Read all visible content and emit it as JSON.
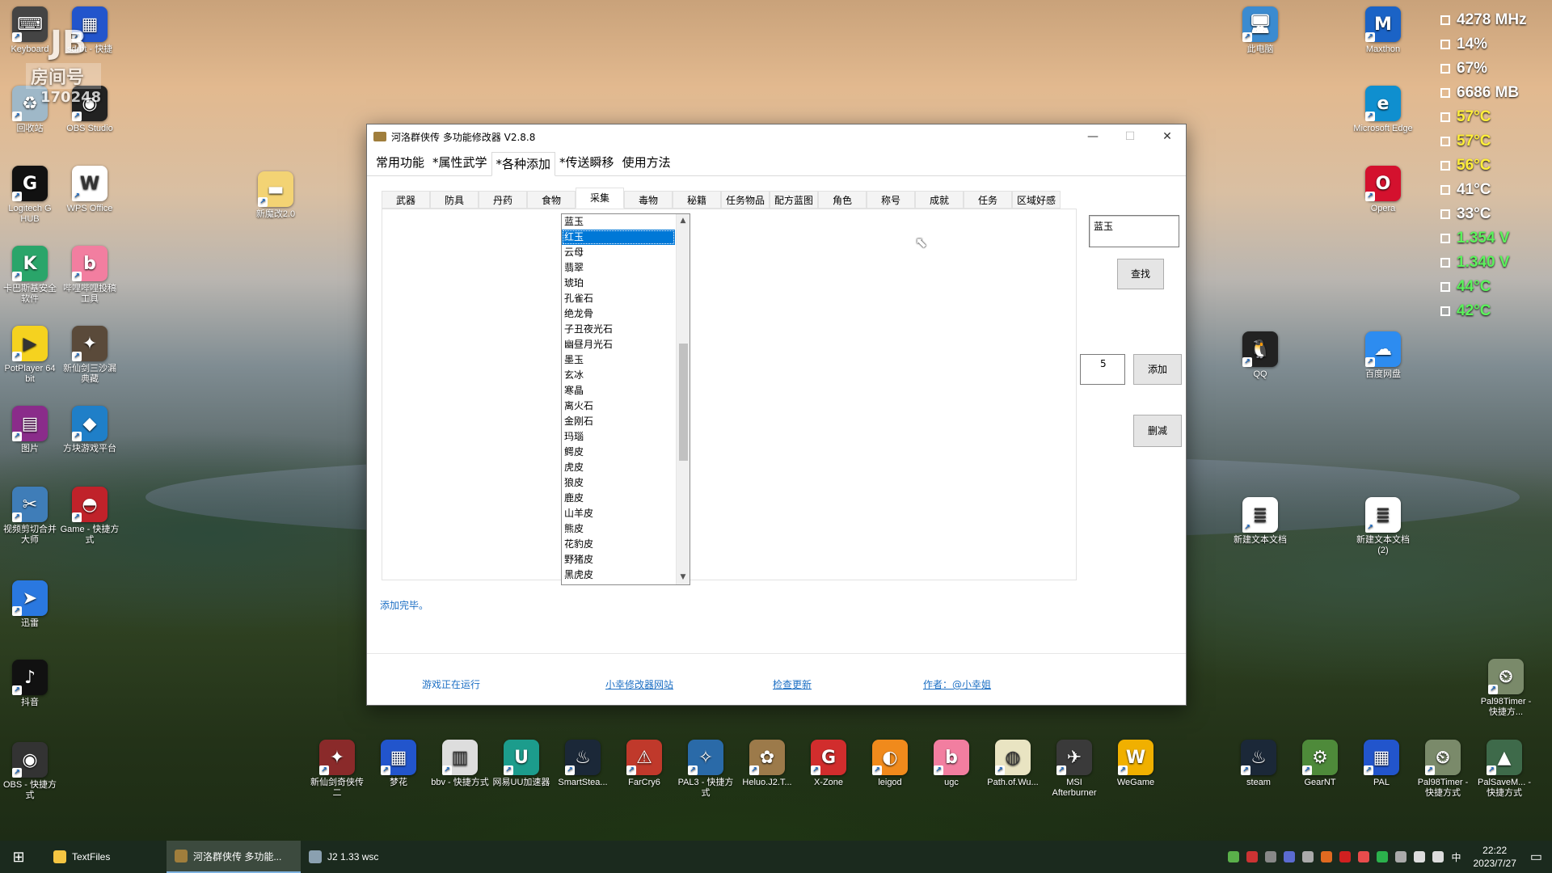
{
  "desktop": {
    "left_icons": [
      {
        "label": "Keyboard",
        "icon": "keyboard-icon",
        "color": "#444444",
        "glyph": "⌨"
      },
      {
        "label": "sdrbt - 快捷",
        "icon": "app-icon",
        "color": "#2255cc",
        "glyph": "▦"
      },
      {
        "label": "回收站",
        "icon": "recycle-bin-icon",
        "color": "#9fb8c8",
        "glyph": "♻"
      },
      {
        "label": "OBS Studio",
        "icon": "obs-icon",
        "color": "#222222",
        "glyph": "◉"
      },
      {
        "label": "Logitech G HUB",
        "icon": "logitech-icon",
        "color": "#111111",
        "glyph": "G"
      },
      {
        "label": "WPS Office",
        "icon": "wps-icon",
        "color": "#ffffff",
        "glyph": "W"
      },
      {
        "label": "卡巴斯基安全软件",
        "icon": "kaspersky-icon",
        "color": "#2aa56a",
        "glyph": "K"
      },
      {
        "label": "哔哩哔哩投稿工具",
        "icon": "bilibili-icon",
        "color": "#f27ea0",
        "glyph": "b"
      },
      {
        "label": "PotPlayer 64 bit",
        "icon": "potplayer-icon",
        "color": "#f5d21f",
        "glyph": "▶"
      },
      {
        "label": "新仙剑三沙漏典藏",
        "icon": "game-icon",
        "color": "#5a4a3a",
        "glyph": "✦"
      },
      {
        "label": "图片",
        "icon": "winrar-icon",
        "color": "#8a2c8a",
        "glyph": "▤"
      },
      {
        "label": "方块游戏平台",
        "icon": "cube-icon",
        "color": "#1f7fc8",
        "glyph": "◆"
      },
      {
        "label": "视频剪切合并大师",
        "icon": "video-cut-icon",
        "color": "#3f7db8",
        "glyph": "✂"
      },
      {
        "label": "Game - 快捷方式",
        "icon": "pokeball-icon",
        "color": "#c0222a",
        "glyph": "◓"
      },
      {
        "label": "迅雷",
        "icon": "xunlei-icon",
        "color": "#2a78e0",
        "glyph": "➤"
      },
      {
        "label": "抖音",
        "icon": "douyin-icon",
        "color": "#111111",
        "glyph": "♪"
      },
      {
        "label": "OBS - 快捷方式",
        "icon": "obs-shortcut-icon",
        "color": "#333333",
        "glyph": "◉"
      }
    ],
    "folder_icon": {
      "label": "新魔改2.0",
      "icon": "folder-icon"
    },
    "right_icons": [
      {
        "label": "此电脑",
        "icon": "computer-icon",
        "color": "#3b8bd0",
        "glyph": "🖥"
      },
      {
        "label": "Maxthon",
        "icon": "maxthon-icon",
        "color": "#1b63c6",
        "glyph": "M"
      },
      {
        "label": "Microsoft Edge",
        "icon": "edge-icon",
        "color": "#0f8fcf",
        "glyph": "e"
      },
      {
        "label": "Opera",
        "icon": "opera-icon",
        "color": "#d4112e",
        "glyph": "O"
      },
      {
        "label": "QQ",
        "icon": "qq-icon",
        "color": "#222222",
        "glyph": "🐧"
      },
      {
        "label": "百度网盘",
        "icon": "baidu-pan-icon",
        "color": "#2d8cf0",
        "glyph": "☁"
      },
      {
        "label": "新建文本文档",
        "icon": "text-file-icon",
        "color": "#ffffff",
        "glyph": "≣"
      },
      {
        "label": "新建文本文档 (2)",
        "icon": "text-file-icon-2",
        "color": "#ffffff",
        "glyph": "≣"
      },
      {
        "label": "Pal98Timer - 快捷方...",
        "icon": "pal98-icon",
        "color": "#7a8a6a",
        "glyph": "⏲"
      }
    ],
    "watermark": "房间号",
    "watermark_sub": "170248",
    "watermark_top": "JB"
  },
  "bottom_row_icons": [
    {
      "label": "新仙剑奇侠传二",
      "icon": "xianjian2-icon",
      "color": "#8a2a2a",
      "glyph": "✦"
    },
    {
      "label": "梦花",
      "icon": "menghua-icon",
      "color": "#2255cc",
      "glyph": "▦"
    },
    {
      "label": "bbv - 快捷方式",
      "icon": "building-icon",
      "color": "#dddddd",
      "glyph": "▥"
    },
    {
      "label": "网易UU加速器",
      "icon": "uu-icon",
      "color": "#1c9c8c",
      "glyph": "U"
    },
    {
      "label": "SmartStea...",
      "icon": "steam-icon",
      "color": "#1b2838",
      "glyph": "♨"
    },
    {
      "label": "FarCry6",
      "icon": "farcry-icon",
      "color": "#c0392b",
      "glyph": "⚠"
    },
    {
      "label": "PAL3 - 快捷方式",
      "icon": "pal3-icon",
      "color": "#2a6aa8",
      "glyph": "✧"
    },
    {
      "label": "Heluo.J2.T...",
      "icon": "heluo-icon",
      "color": "#9c7a4a",
      "glyph": "✿"
    },
    {
      "label": "X-Zone",
      "icon": "xzone-icon",
      "color": "#d12d2d",
      "glyph": "G"
    },
    {
      "label": "leigod",
      "icon": "leigod-icon",
      "color": "#f08a1c",
      "glyph": "◐"
    },
    {
      "label": "ugc",
      "icon": "ugc-icon",
      "color": "#f27ea0",
      "glyph": "b"
    },
    {
      "label": "Path.of.Wu...",
      "icon": "path-icon",
      "color": "#e9e4c2",
      "glyph": "◍"
    },
    {
      "label": "MSI Afterburner",
      "icon": "msi-icon",
      "color": "#3a3a3a",
      "glyph": "✈"
    },
    {
      "label": "WeGame",
      "icon": "wegame-icon",
      "color": "#f0b000",
      "glyph": "W"
    },
    {
      "label": "steam",
      "icon": "steam-icon-2",
      "color": "#1b2838",
      "glyph": "♨"
    },
    {
      "label": "GearNT",
      "icon": "gearnt-icon",
      "color": "#4e8a3a",
      "glyph": "⚙"
    },
    {
      "label": "PAL",
      "icon": "pal-icon",
      "color": "#2255cc",
      "glyph": "▦"
    },
    {
      "label": "Pal98Timer - 快捷方式",
      "icon": "pal98-timer-icon",
      "color": "#7a8a6a",
      "glyph": "⏲"
    },
    {
      "label": "PalSaveM... - 快捷方式",
      "icon": "palsave-icon",
      "color": "#3e6a4a",
      "glyph": "▲"
    }
  ],
  "sys_monitor": [
    {
      "text": "4278 MHz",
      "color": "#ffffff"
    },
    {
      "text": "14%",
      "color": "#ffffff"
    },
    {
      "text": "67%",
      "color": "#ffffff"
    },
    {
      "text": "6686 MB",
      "color": "#ffffff"
    },
    {
      "text": "57°C",
      "color": "#ffef3a"
    },
    {
      "text": "57°C",
      "color": "#ffef3a"
    },
    {
      "text": "56°C",
      "color": "#ffef3a"
    },
    {
      "text": "41°C",
      "color": "#ffffff"
    },
    {
      "text": "33°C",
      "color": "#ffffff"
    },
    {
      "text": "1.354 V",
      "color": "#5cf25c"
    },
    {
      "text": "1.340 V",
      "color": "#5cf25c"
    },
    {
      "text": "44°C",
      "color": "#5cf25c"
    },
    {
      "text": "42°C",
      "color": "#5cf25c"
    }
  ],
  "window": {
    "title": "河洛群侠传 多功能修改器  V2.8.8",
    "main_tabs": [
      "常用功能",
      "*属性武学",
      "*各种添加",
      "*传送瞬移",
      "使用方法"
    ],
    "active_main_tab": 2,
    "sub_tabs": [
      "武器",
      "防具",
      "丹药",
      "食物",
      "采集",
      "毒物",
      "秘籍",
      "任务物品",
      "配方蓝图",
      "角色",
      "称号",
      "成就",
      "任务",
      "区域好感"
    ],
    "active_sub_tab": 4,
    "list_items": [
      "蓝玉",
      "红玉",
      "云母",
      "翡翠",
      "琥珀",
      "孔雀石",
      "绝龙骨",
      "子丑夜光石",
      "幽昼月光石",
      "墨玉",
      "玄冰",
      "寒晶",
      "离火石",
      "金刚石",
      "玛瑙",
      "鳄皮",
      "虎皮",
      "狼皮",
      "鹿皮",
      "山羊皮",
      "熊皮",
      "花豹皮",
      "野猪皮",
      "黑虎皮"
    ],
    "selected_index": 1,
    "search_value": "蓝玉",
    "search_button": "查找",
    "count_value": "5",
    "add_button": "添加",
    "delete_button": "删减",
    "status_message": "添加完毕。",
    "footer": {
      "game_status": "游戏正在运行",
      "site_link": "小幸修改器网站",
      "update_link": "检查更新",
      "author_link": "作者：@小幸姐"
    }
  },
  "taskbar": {
    "items": [
      {
        "label": "TextFiles",
        "icon": "folder-icon",
        "color": "#f5c542",
        "active": false
      },
      {
        "label": "河洛群侠传 多功能...",
        "icon": "trainer-icon",
        "color": "#a07e3c",
        "active": true
      },
      {
        "label": "J2 1.33 wsc",
        "icon": "game-icon",
        "color": "#8aa0b0",
        "active": false
      }
    ],
    "ime": "中",
    "time": "22:22",
    "date": "2023/7/27"
  }
}
